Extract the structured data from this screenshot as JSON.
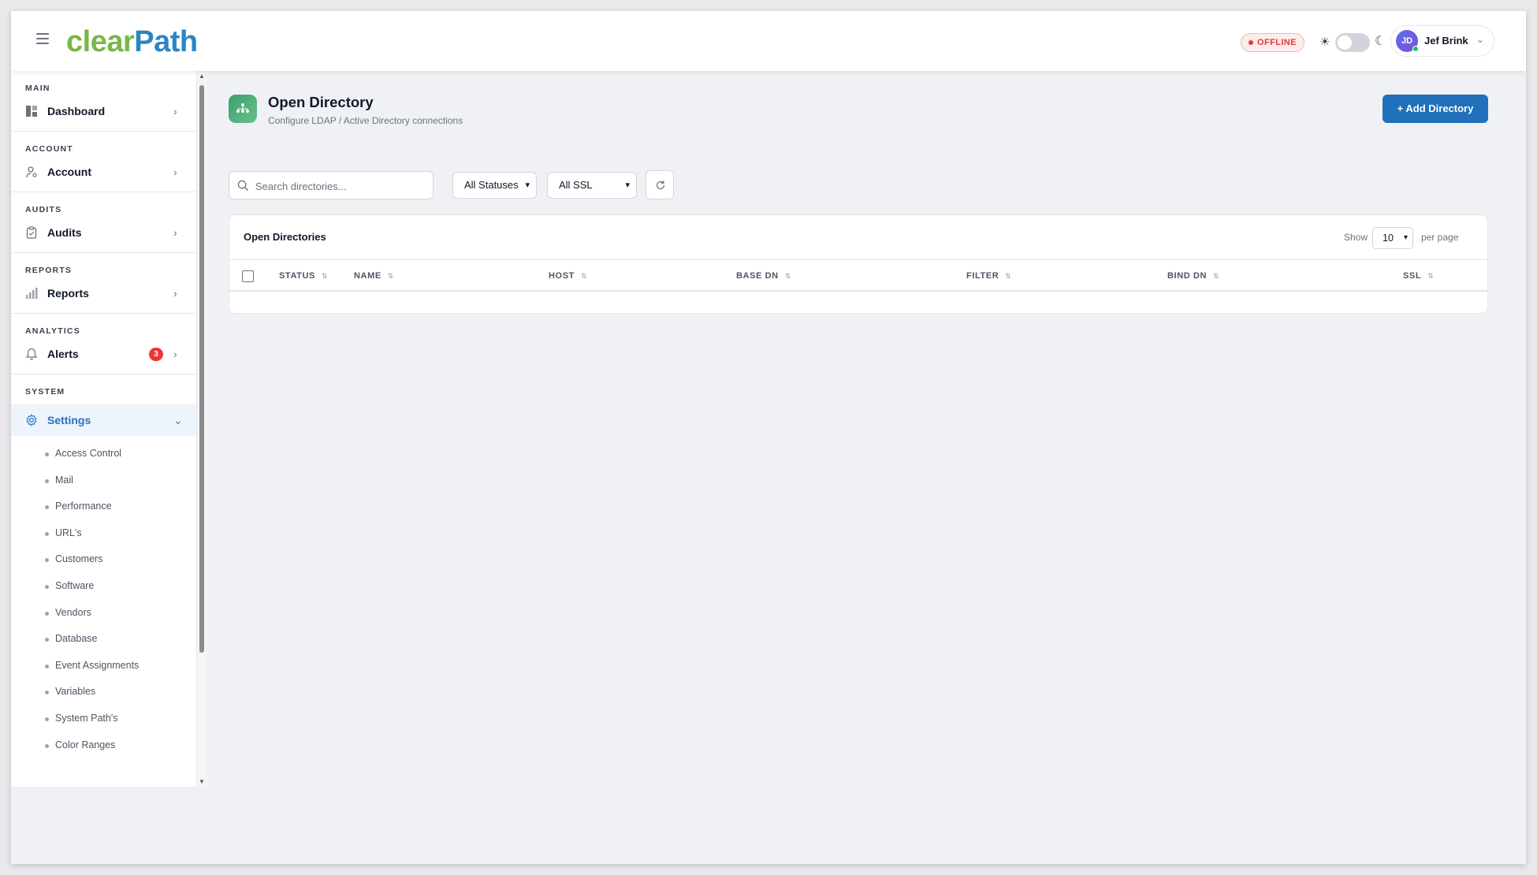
{
  "header": {
    "logo_part1": "clear",
    "logo_part2": "Path",
    "status_badge": "OFFLINE",
    "user_initials": "JD",
    "user_name": "Jef Brink"
  },
  "sidebar": {
    "sections": [
      {
        "heading": "MAIN",
        "item": "Dashboard"
      },
      {
        "heading": "ACCOUNT",
        "item": "Account"
      },
      {
        "heading": "AUDITS",
        "item": "Audits"
      },
      {
        "heading": "REPORTS",
        "item": "Reports"
      },
      {
        "heading": "ANALYTICS",
        "item": "Alerts",
        "badge": "3"
      },
      {
        "heading": "SYSTEM",
        "item": "Settings"
      }
    ],
    "settings_subitems": [
      "Access Control",
      "Mail",
      "Performance",
      "URL's",
      "Customers",
      "Software",
      "Vendors",
      "Database",
      "Event Assignments",
      "Variables",
      "System Path's",
      "Color Ranges"
    ]
  },
  "page": {
    "title": "Open Directory",
    "subtitle": "Configure LDAP / Active Directory connections",
    "add_button": "+ Add Directory"
  },
  "filters": {
    "search_placeholder": "Search directories...",
    "status_select": "All Statuses",
    "ssl_select": "All SSL"
  },
  "table": {
    "title": "Open Directories",
    "show_label": "Show",
    "per_page_value": "10",
    "per_page_label": "per page",
    "columns": [
      "STATUS",
      "NAME",
      "HOST",
      "BASE DN",
      "FILTER",
      "BIND DN",
      "SSL"
    ],
    "rows": []
  },
  "colors": {
    "accent": "#1f6fbb",
    "logo_green": "#7ab648",
    "logo_blue": "#2a86c5",
    "offline_red": "#dc3b3b"
  }
}
